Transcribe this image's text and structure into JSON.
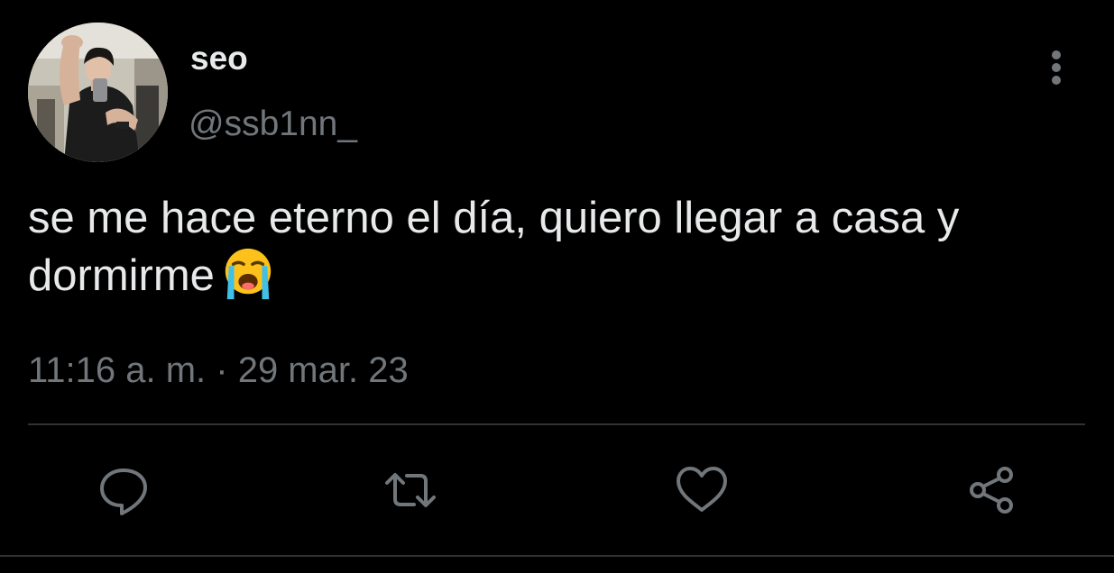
{
  "tweet": {
    "display_name": "seo",
    "handle": "@ssb1nn_",
    "text": "se me hace eterno el día, quiero llegar a casa y dormirme",
    "emoji": "loudly-crying-face",
    "timestamp": "11:16 a. m. · 29 mar. 23"
  },
  "icons": {
    "more": "more-vertical-icon",
    "reply": "reply-icon",
    "retweet": "retweet-icon",
    "like": "heart-icon",
    "share": "share-icon"
  },
  "colors": {
    "background": "#000000",
    "primary_text": "#e7e9ea",
    "secondary_text": "#71767b",
    "divider": "#2f3336"
  }
}
